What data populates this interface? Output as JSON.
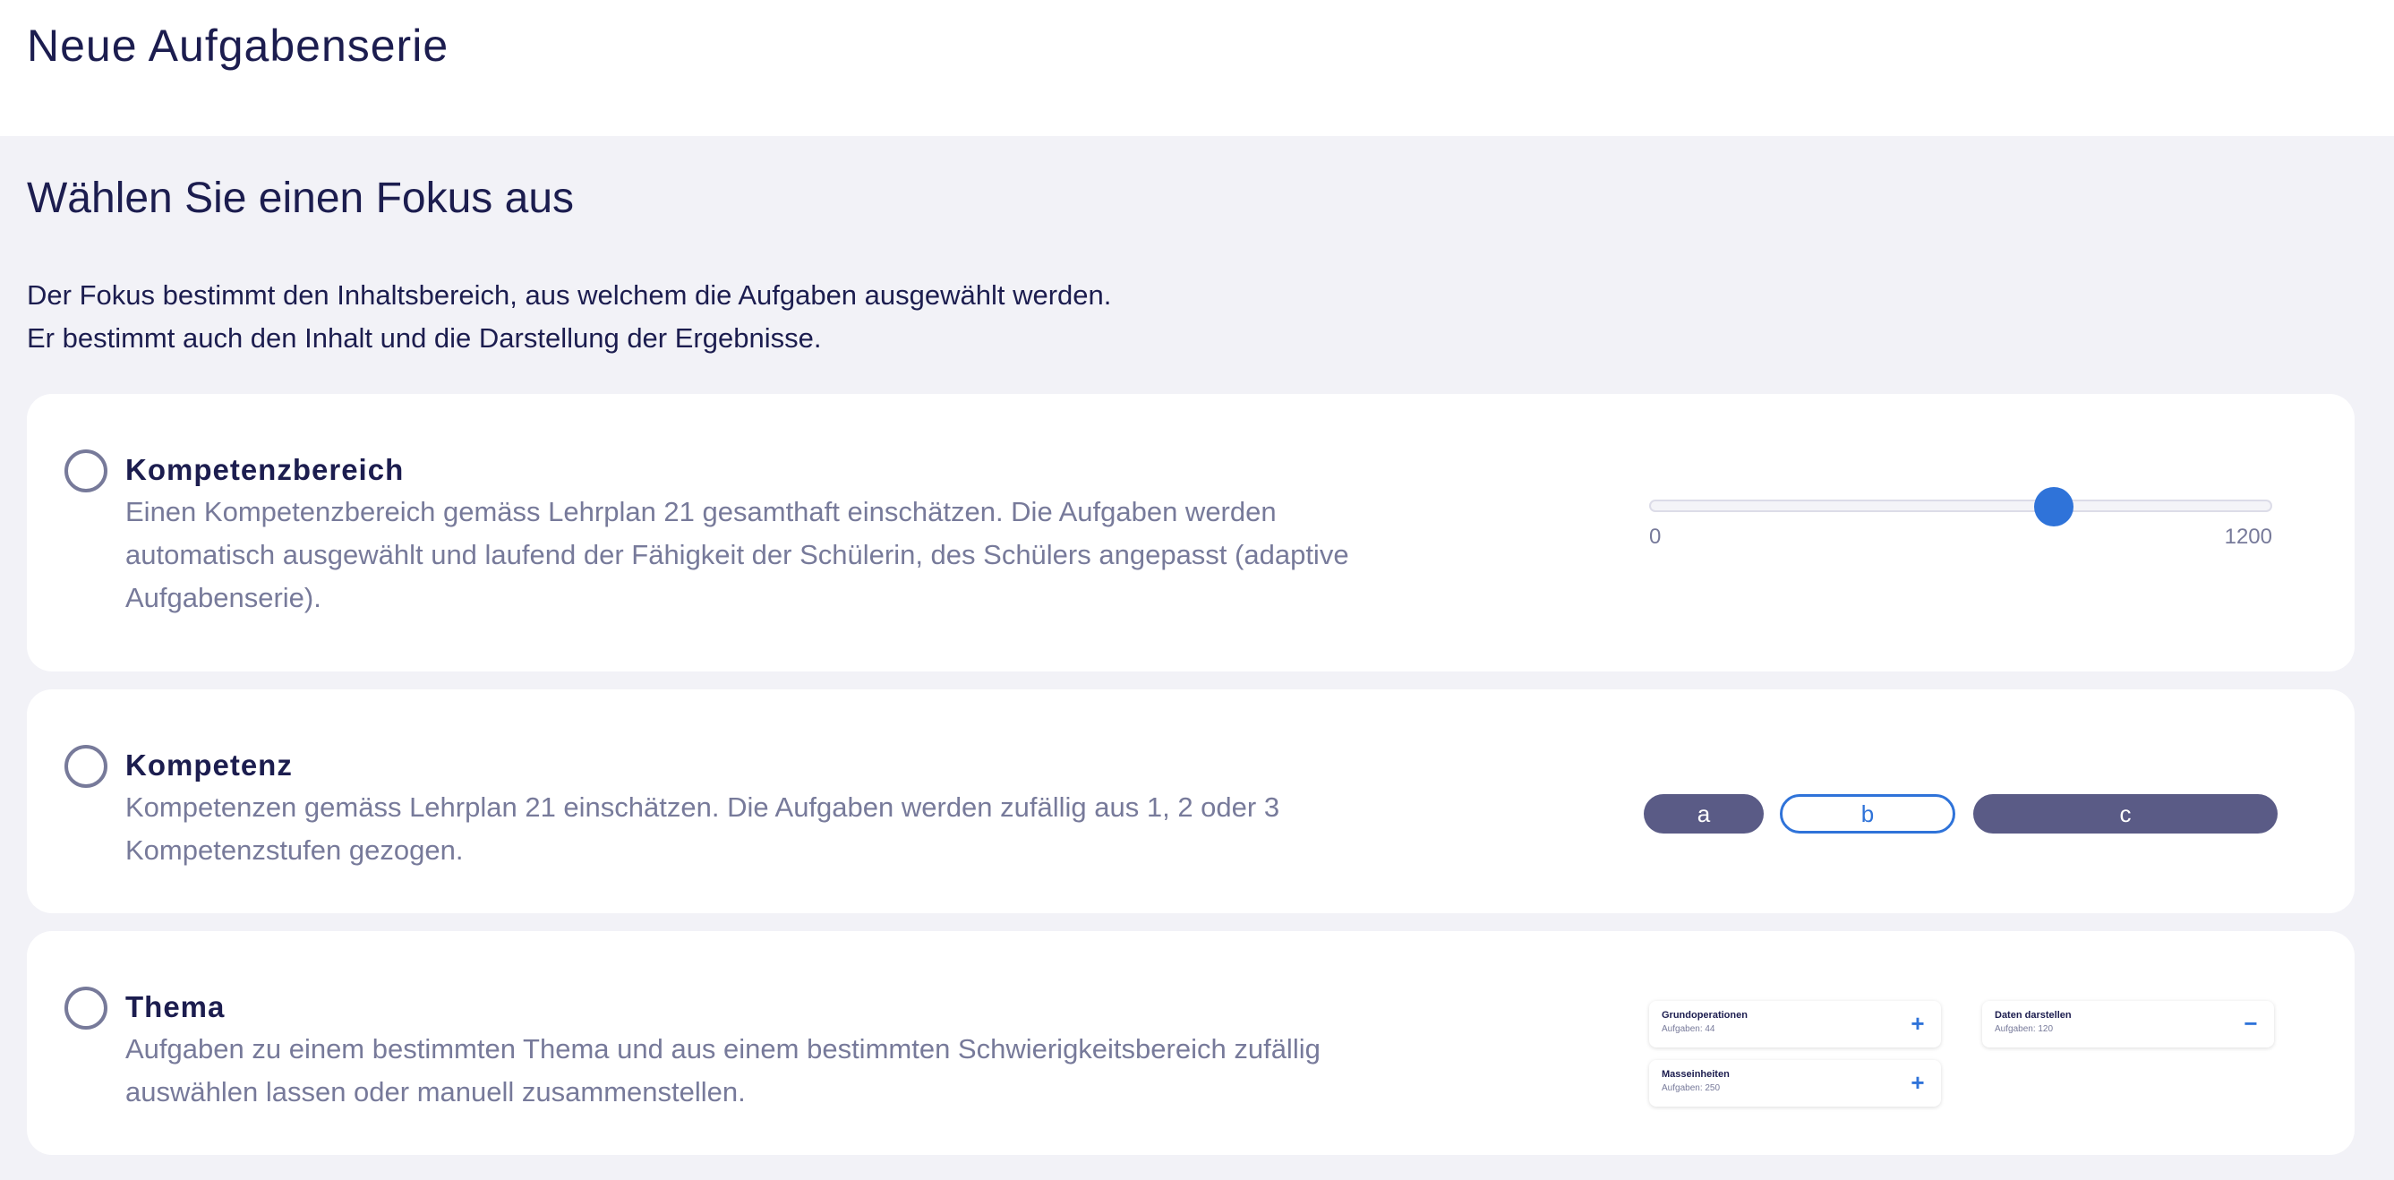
{
  "header": {
    "title": "Neue Aufgabenserie"
  },
  "section": {
    "title": "Wählen Sie einen Fokus aus",
    "intro_line1": "Der Fokus bestimmt den Inhaltsbereich, aus welchem die Aufgaben ausgewählt werden.",
    "intro_line2": "Er bestimmt auch den Inhalt und die Darstellung der Ergebnisse."
  },
  "options": [
    {
      "title": "Kompetenzbereich",
      "description": "Einen Kompetenzbereich gemäss Lehrplan 21 gesamthaft einschätzen. Die Aufgaben werden automatisch ausgewählt und laufend der Fähigkeit der Schülerin, des Schülers angepasst (adaptive Aufgabenserie).",
      "selected": false,
      "slider": {
        "min": 0,
        "max": 1200,
        "min_label": "0",
        "max_label": "1200",
        "value": 780
      }
    },
    {
      "title": "Kompetenz",
      "description": "Kompetenzen gemäss Lehrplan 21 einschätzen. Die Aufgaben werden zufällig aus 1, 2 oder 3 Kompetenzstufen gezogen.",
      "selected": false,
      "levels": [
        {
          "label": "a",
          "active": true
        },
        {
          "label": "b",
          "active": false
        },
        {
          "label": "c",
          "active": true
        }
      ]
    },
    {
      "title": "Thema",
      "description": "Aufgaben zu einem bestimmten Thema und aus einem bestimmten Schwierigkeitsbereich zufällig auswählen lassen oder manuell zusammenstellen.",
      "selected": false,
      "topics": [
        {
          "name": "Grundoperationen",
          "count": "Aufgaben: 44",
          "action": "+"
        },
        {
          "name": "Masseinheiten",
          "count": "Aufgaben: 250",
          "action": "+"
        },
        {
          "name": "Daten darstellen",
          "count": "Aufgaben: 120",
          "action": "−"
        }
      ]
    }
  ],
  "colors": {
    "accent": "#2f73d9",
    "navy": "#1c1d4f",
    "muted": "#777a9a",
    "pill_filled": "#5a5b86",
    "background": "#f2f2f7"
  }
}
